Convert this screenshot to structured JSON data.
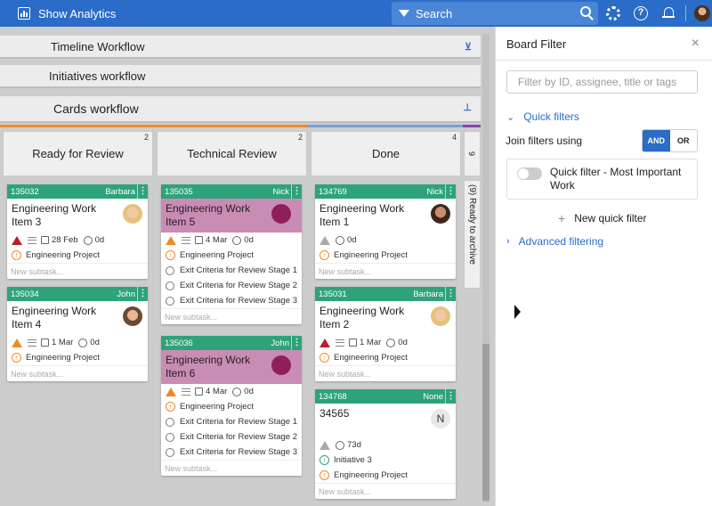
{
  "topbar": {
    "title": "Show Analytics",
    "search_label": "Search",
    "icons": [
      "chart-icon",
      "filter-icon",
      "search-icon",
      "gear-icon",
      "help-icon",
      "bell-icon",
      "avatar"
    ]
  },
  "workflows": [
    {
      "label": "Timeline Workflow"
    },
    {
      "label": "Initiatives workflow"
    },
    {
      "label": "Cards workflow"
    }
  ],
  "columns": [
    {
      "title": "Ready for Review",
      "count": "2"
    },
    {
      "title": "Technical Review",
      "count": "2"
    },
    {
      "title": "Done",
      "count": "4"
    }
  ],
  "archive": {
    "count": "9",
    "label": "(9) Ready to archive"
  },
  "cards": [
    {
      "id": "135032",
      "user": "Barbara",
      "title": "Engineering Work Item 3",
      "date": "28 Feb",
      "days": "0d",
      "project": "Engineering Project",
      "subtask": "New subtask..."
    },
    {
      "id": "135034",
      "user": "John",
      "title": "Engineering Work Item 4",
      "date": "1 Mar",
      "days": "0d",
      "project": "Engineering Project",
      "subtask": "New subtask..."
    },
    {
      "id": "135035",
      "user": "Nick",
      "title": "Engineering Work Item 5",
      "date": "4 Mar",
      "days": "0d",
      "project": "Engineering Project",
      "checks": [
        "Exit Criteria for Review Stage 1",
        "Exit Criteria for Review Stage 2",
        "Exit Criteria for Review Stage 3"
      ],
      "subtask": "New subtask..."
    },
    {
      "id": "135036",
      "user": "John",
      "title": "Engineering Work Item 6",
      "date": "4 Mar",
      "days": "0d",
      "project": "Engineering Project",
      "checks": [
        "Exit Criteria for Review Stage 1",
        "Exit Criteria for Review Stage 2",
        "Exit Criteria for Review Stage 3"
      ],
      "subtask": "New subtask..."
    },
    {
      "id": "134769",
      "user": "Nick",
      "title": "Engineering Work Item 1",
      "days": "0d",
      "project": "Engineering Project",
      "subtask": "New subtask..."
    },
    {
      "id": "135031",
      "user": "Barbara",
      "title": "Engineering Work Item 2",
      "date": "1 Mar",
      "days": "0d",
      "project": "Engineering Project",
      "subtask": "New subtask..."
    },
    {
      "id": "134768",
      "user": "None",
      "title": "34565",
      "avatar_letter": "N",
      "days": "73d",
      "initiative": "Initiative 3",
      "project": "Engineering Project",
      "subtask": "New subtask..."
    }
  ],
  "panel": {
    "title": "Board Filter",
    "close": "×",
    "search_placeholder": "Filter by ID, assignee, title or tags",
    "quick_filters_label": "Quick filters",
    "join_label": "Join filters using",
    "and_label": "AND",
    "or_label": "OR",
    "quick_filter_name": "Quick filter - Most Important Work",
    "new_quick_filter": "New quick filter",
    "advanced_label": "Advanced filtering"
  },
  "colors": {
    "brand": "#2a6cc7",
    "card_header": "#2ea37a",
    "highlight": "#c98cb4",
    "warn_red": "#b8202c",
    "warn_orange": "#ef8a2b"
  }
}
